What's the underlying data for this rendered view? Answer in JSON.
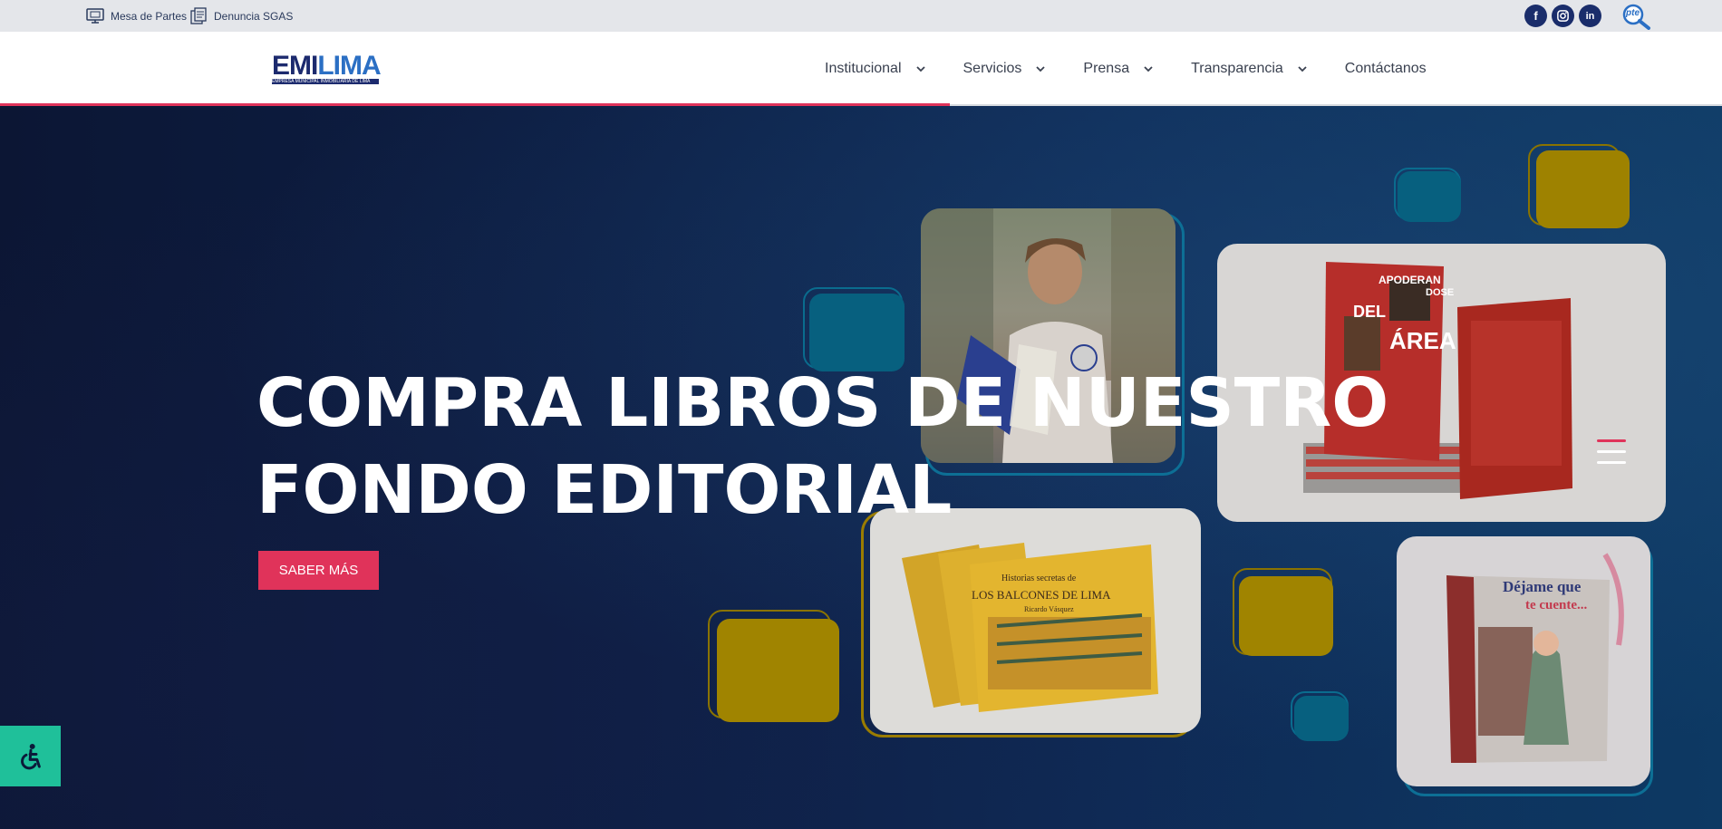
{
  "topbar": {
    "mesa_partes": "Mesa de Partes",
    "denuncia": "Denuncia SGAS",
    "social": [
      {
        "name": "facebook",
        "glyph": "f"
      },
      {
        "name": "instagram",
        "glyph": "◎"
      },
      {
        "name": "linkedin",
        "glyph": "in"
      }
    ],
    "pte_label": "pte"
  },
  "header": {
    "logo_main_a": "EMI",
    "logo_main_b": "LIMA",
    "logo_sub": "EMPRESA MUNICIPAL INMOBILIARIA DE LIMA",
    "nav": [
      {
        "label": "Institucional",
        "has_dropdown": true
      },
      {
        "label": "Servicios",
        "has_dropdown": true
      },
      {
        "label": "Prensa",
        "has_dropdown": true
      },
      {
        "label": "Transparencia",
        "has_dropdown": true
      },
      {
        "label": "Contáctanos",
        "has_dropdown": false
      }
    ]
  },
  "hero": {
    "title_line1": "COMPRA LIBROS DE NUESTRO",
    "title_line2": "FONDO EDITORIAL",
    "cta_label": "SABER MÁS",
    "book1": {
      "title_top": "APODERAN",
      "title_mid": "DOSE",
      "title_big1": "DEL",
      "title_big2": "ÁREA"
    },
    "book2": {
      "title_small": "Historias secretas de",
      "title_main": "LOS BALCONES DE LIMA",
      "author": "Ricardo Vásquez"
    },
    "book3": {
      "line1": "Déjame que",
      "line2": "te cuente..."
    }
  },
  "colors": {
    "accent": "#e0335a",
    "navy": "#1c2a6e",
    "teal_square": "#0a6c8e",
    "gold_square": "#c9a400",
    "a11y_green": "#1fc09a"
  },
  "icons": {
    "mesa_partes": "computer-document-icon",
    "denuncia": "document-stack-icon",
    "search": "search-icon",
    "menu": "hamburger-menu-icon",
    "accessibility": "wheelchair-icon",
    "dropdown": "chevron-down-icon"
  }
}
